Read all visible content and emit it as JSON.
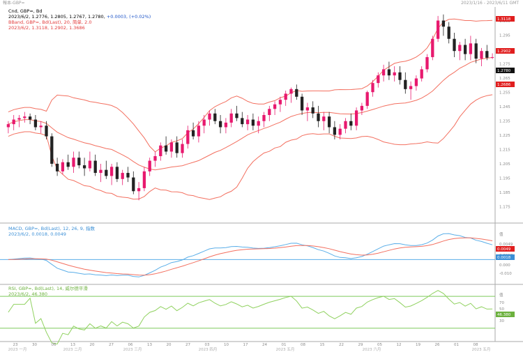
{
  "header": {
    "left": "報本-GBP=",
    "right": "2023/1/16 - 2023/6/11 GMT"
  },
  "price_legend": {
    "line1": "Cnd, GBP=, Bd",
    "line1_values": "2023/6/2, 1.2776, 1.2805, 1.2767, 1.2780,",
    "line1_change": "+0.0003, (+0.02%)",
    "line2": "BBand, GBP=, Bd(Last), 20, 简单, 2.0",
    "line3": "2023/6/2, 1.3118, 1.2902, 1.3686"
  },
  "macd_legend": {
    "line1": "MACD, GBP=, Bd(Last), 12, 26, 9, 指数",
    "line2": "2023/6/2, 0.0018, 0.0049"
  },
  "rsi_legend": {
    "line1": "RSI, GBP=, Bd(Last), 14, 威尔德平滑",
    "line2": "2023/6/2, 46.380"
  },
  "price_axis": {
    "ticks": [
      "1.305",
      "1.295",
      "1.285",
      "1.275",
      "1.265",
      "1.255",
      "1.245",
      "1.235",
      "1.225",
      "1.215",
      "1.205",
      "1.195",
      "1.185",
      "1.175"
    ],
    "badges": [
      "1.3118",
      "1.2902",
      "1.2780",
      "1.2686"
    ]
  },
  "macd_axis": {
    "ticks": [
      "值",
      "0.0049",
      "0.0018",
      "0.000",
      "-0.010"
    ],
    "badges": [
      "0.0049",
      "0.0018"
    ]
  },
  "rsi_axis": {
    "ticks": [
      "值",
      "70",
      "50",
      "46.380",
      "30"
    ],
    "badges": [
      "46.380"
    ]
  },
  "time_axis": {
    "ticks": [
      "23",
      "30",
      "06",
      "13",
      "20",
      "27",
      "06",
      "13",
      "20",
      "27",
      "03",
      "10",
      "17",
      "24",
      "01",
      "08",
      "15",
      "22",
      "29",
      "05",
      "12",
      "19",
      "26",
      "01",
      "08"
    ],
    "months": [
      "2023 一月",
      "2023 二月",
      "2023 三月",
      "2023 四月",
      "2023 五月",
      "2023 六月",
      "2023 五月"
    ]
  },
  "colors": {
    "up": "#e8196e",
    "down": "#222222",
    "band": "#f36f5f",
    "macd": "#5aaee8",
    "signal": "#f36f5f",
    "rsi": "#8fd15e",
    "rsi_level": "#7cc95a",
    "zero": "#5aaee8",
    "change": "#1e55c8"
  },
  "chart_data": [
    {
      "type": "candlestick",
      "series_name": "GBP=",
      "yrange": [
        1.17,
        1.31
      ],
      "candles": [
        [
          1.232,
          1.236,
          1.228,
          1.234
        ],
        [
          1.234,
          1.24,
          1.23,
          1.237
        ],
        [
          1.237,
          1.24,
          1.232,
          1.238
        ],
        [
          1.238,
          1.242,
          1.235,
          1.239
        ],
        [
          1.239,
          1.241,
          1.234,
          1.237
        ],
        [
          1.237,
          1.24,
          1.23,
          1.232
        ],
        [
          1.232,
          1.236,
          1.228,
          1.233
        ],
        [
          1.233,
          1.236,
          1.224,
          1.226
        ],
        [
          1.226,
          1.228,
          1.206,
          1.208
        ],
        [
          1.208,
          1.212,
          1.2,
          1.203
        ],
        [
          1.203,
          1.211,
          1.201,
          1.209
        ],
        [
          1.209,
          1.214,
          1.204,
          1.206
        ],
        [
          1.206,
          1.216,
          1.202,
          1.212
        ],
        [
          1.212,
          1.216,
          1.205,
          1.207
        ],
        [
          1.207,
          1.212,
          1.2,
          1.205
        ],
        [
          1.205,
          1.216,
          1.203,
          1.21
        ],
        [
          1.21,
          1.214,
          1.2,
          1.202
        ],
        [
          1.202,
          1.208,
          1.196,
          1.204
        ],
        [
          1.204,
          1.21,
          1.198,
          1.2
        ],
        [
          1.2,
          1.208,
          1.194,
          1.206
        ],
        [
          1.206,
          1.209,
          1.196,
          1.198
        ],
        [
          1.198,
          1.204,
          1.194,
          1.202
        ],
        [
          1.202,
          1.206,
          1.196,
          1.199
        ],
        [
          1.199,
          1.203,
          1.188,
          1.19
        ],
        [
          1.19,
          1.196,
          1.184,
          1.192
        ],
        [
          1.192,
          1.206,
          1.19,
          1.203
        ],
        [
          1.203,
          1.212,
          1.2,
          1.21
        ],
        [
          1.21,
          1.216,
          1.206,
          1.213
        ],
        [
          1.213,
          1.222,
          1.21,
          1.22
        ],
        [
          1.22,
          1.226,
          1.214,
          1.216
        ],
        [
          1.216,
          1.224,
          1.212,
          1.222
        ],
        [
          1.222,
          1.226,
          1.212,
          1.215
        ],
        [
          1.215,
          1.224,
          1.212,
          1.221
        ],
        [
          1.221,
          1.233,
          1.218,
          1.23
        ],
        [
          1.23,
          1.235,
          1.224,
          1.226
        ],
        [
          1.226,
          1.236,
          1.222,
          1.233
        ],
        [
          1.233,
          1.24,
          1.228,
          1.237
        ],
        [
          1.237,
          1.243,
          1.233,
          1.241
        ],
        [
          1.241,
          1.244,
          1.234,
          1.236
        ],
        [
          1.236,
          1.24,
          1.228,
          1.232
        ],
        [
          1.232,
          1.238,
          1.228,
          1.235
        ],
        [
          1.235,
          1.244,
          1.232,
          1.241
        ],
        [
          1.241,
          1.246,
          1.236,
          1.238
        ],
        [
          1.238,
          1.242,
          1.232,
          1.234
        ],
        [
          1.234,
          1.24,
          1.23,
          1.237
        ],
        [
          1.237,
          1.241,
          1.23,
          1.233
        ],
        [
          1.233,
          1.239,
          1.228,
          1.236
        ],
        [
          1.236,
          1.242,
          1.232,
          1.24
        ],
        [
          1.24,
          1.246,
          1.236,
          1.244
        ],
        [
          1.244,
          1.249,
          1.24,
          1.247
        ],
        [
          1.247,
          1.252,
          1.242,
          1.25
        ],
        [
          1.25,
          1.256,
          1.246,
          1.254
        ],
        [
          1.254,
          1.258,
          1.248,
          1.257
        ],
        [
          1.257,
          1.26,
          1.25,
          1.252
        ],
        [
          1.252,
          1.254,
          1.24,
          1.243
        ],
        [
          1.243,
          1.248,
          1.236,
          1.245
        ],
        [
          1.245,
          1.249,
          1.238,
          1.241
        ],
        [
          1.241,
          1.246,
          1.232,
          1.236
        ],
        [
          1.236,
          1.242,
          1.23,
          1.239
        ],
        [
          1.239,
          1.242,
          1.228,
          1.232
        ],
        [
          1.232,
          1.236,
          1.224,
          1.227
        ],
        [
          1.227,
          1.234,
          1.224,
          1.231
        ],
        [
          1.231,
          1.238,
          1.228,
          1.236
        ],
        [
          1.236,
          1.241,
          1.23,
          1.233
        ],
        [
          1.233,
          1.245,
          1.23,
          1.243
        ],
        [
          1.243,
          1.248,
          1.24,
          1.246
        ],
        [
          1.246,
          1.256,
          1.244,
          1.255
        ],
        [
          1.255,
          1.263,
          1.252,
          1.261
        ],
        [
          1.261,
          1.268,
          1.258,
          1.266
        ],
        [
          1.266,
          1.273,
          1.262,
          1.27
        ],
        [
          1.27,
          1.275,
          1.263,
          1.266
        ],
        [
          1.266,
          1.272,
          1.262,
          1.268
        ],
        [
          1.268,
          1.272,
          1.26,
          1.263
        ],
        [
          1.263,
          1.268,
          1.254,
          1.257
        ],
        [
          1.257,
          1.262,
          1.25,
          1.259
        ],
        [
          1.259,
          1.266,
          1.256,
          1.264
        ],
        [
          1.264,
          1.272,
          1.262,
          1.27
        ],
        [
          1.27,
          1.28,
          1.268,
          1.278
        ],
        [
          1.278,
          1.292,
          1.276,
          1.29
        ],
        [
          1.29,
          1.305,
          1.288,
          1.302
        ],
        [
          1.302,
          1.306,
          1.292,
          1.298
        ],
        [
          1.298,
          1.301,
          1.287,
          1.29
        ],
        [
          1.29,
          1.294,
          1.278,
          1.282
        ],
        [
          1.282,
          1.288,
          1.276,
          1.286
        ],
        [
          1.286,
          1.29,
          1.276,
          1.28
        ],
        [
          1.28,
          1.292,
          1.276,
          1.287
        ],
        [
          1.287,
          1.29,
          1.274,
          1.277
        ],
        [
          1.277,
          1.284,
          1.272,
          1.282
        ],
        [
          1.282,
          1.286,
          1.276,
          1.2776
        ],
        [
          1.2776,
          1.2805,
          1.2767,
          1.278
        ]
      ]
    },
    {
      "type": "line",
      "series_name": "MACD",
      "values": [
        0.0018,
        0.0049
      ]
    },
    {
      "type": "line",
      "series_name": "RSI",
      "values": [
        46.38
      ]
    }
  ]
}
